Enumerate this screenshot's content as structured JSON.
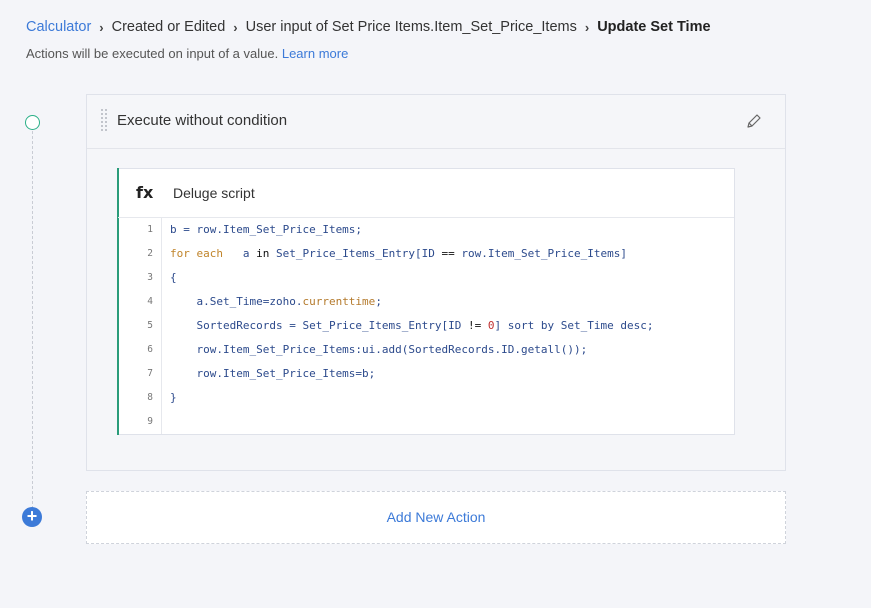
{
  "breadcrumb": {
    "items": [
      "Calculator",
      "Created or Edited",
      "User input of Set Price Items.Item_Set_Price_Items",
      "Update Set Time"
    ]
  },
  "subtitle": {
    "text": "Actions will be executed on input of a value.",
    "link": "Learn more"
  },
  "action": {
    "title": "Execute without condition",
    "script": {
      "icon": "fx",
      "label": "Deluge script",
      "lines": [
        {
          "n": "1",
          "tokens": [
            [
              "t",
              "b = row.Item_Set_Price_Items;"
            ]
          ]
        },
        {
          "n": "2",
          "tokens": [
            [
              "kw",
              "for each "
            ],
            [
              "t",
              "  a "
            ],
            [
              "op",
              "in"
            ],
            [
              "t",
              " Set_Price_Items_Entry[ID "
            ],
            [
              "op",
              "=="
            ],
            [
              "t",
              " row.Item_Set_Price_Items]"
            ]
          ]
        },
        {
          "n": "3",
          "tokens": [
            [
              "t",
              "{"
            ]
          ]
        },
        {
          "n": "4",
          "tokens": [
            [
              "t",
              "    a.Set_Time=zoho."
            ],
            [
              "fn",
              "currenttime"
            ],
            [
              "t",
              ";"
            ]
          ]
        },
        {
          "n": "5",
          "tokens": [
            [
              "t",
              "    SortedRecords = Set_Price_Items_Entry[ID "
            ],
            [
              "op",
              "!="
            ],
            [
              "t",
              " "
            ],
            [
              "num",
              "0"
            ],
            [
              "t",
              "] sort by Set_Time desc;"
            ]
          ]
        },
        {
          "n": "6",
          "tokens": [
            [
              "t",
              "    row.Item_Set_Price_Items:ui.add(SortedRecords.ID.getall());"
            ]
          ]
        },
        {
          "n": "7",
          "tokens": [
            [
              "t",
              "    row.Item_Set_Price_Items=b;"
            ]
          ]
        },
        {
          "n": "8",
          "tokens": [
            [
              "t",
              "}"
            ]
          ]
        },
        {
          "n": "9",
          "tokens": []
        }
      ]
    }
  },
  "add_action": {
    "label": "Add New Action",
    "icon": "plus-icon"
  },
  "colors": {
    "accent": "#3c7ad8",
    "success": "#2bb088"
  }
}
